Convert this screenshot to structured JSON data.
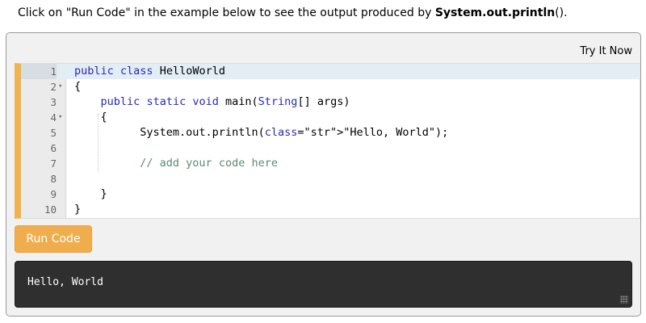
{
  "intro": {
    "text_before": "Click on \"Run Code\" in the example below to see the output produced by ",
    "method_bold": "System.out.println",
    "text_after": "()."
  },
  "example": {
    "try_it_label": "Try It Now",
    "run_button_label": "Run Code",
    "output_text": "Hello, World",
    "code_lines": [
      {
        "num": "1",
        "fold": "",
        "text": "public class HelloWorld"
      },
      {
        "num": "2",
        "fold": "▾",
        "text": "{"
      },
      {
        "num": "3",
        "fold": "",
        "text": "    public static void main(String[] args)"
      },
      {
        "num": "4",
        "fold": "▾",
        "text": "    {"
      },
      {
        "num": "5",
        "fold": "",
        "text": "          System.out.println(\"Hello, World\");"
      },
      {
        "num": "6",
        "fold": "",
        "text": ""
      },
      {
        "num": "7",
        "fold": "",
        "text": "          // add your code here"
      },
      {
        "num": "8",
        "fold": "",
        "text": ""
      },
      {
        "num": "9",
        "fold": "",
        "text": "    }"
      },
      {
        "num": "10",
        "fold": "",
        "text": "}"
      }
    ]
  },
  "colors": {
    "accent_orange": "#f0ad4e",
    "editor_left_bar": "#efb44f",
    "output_background": "#2f2f2f",
    "keyword": "#2a2ab8",
    "string": "#1a1ad4",
    "comment": "#5c8a73"
  }
}
